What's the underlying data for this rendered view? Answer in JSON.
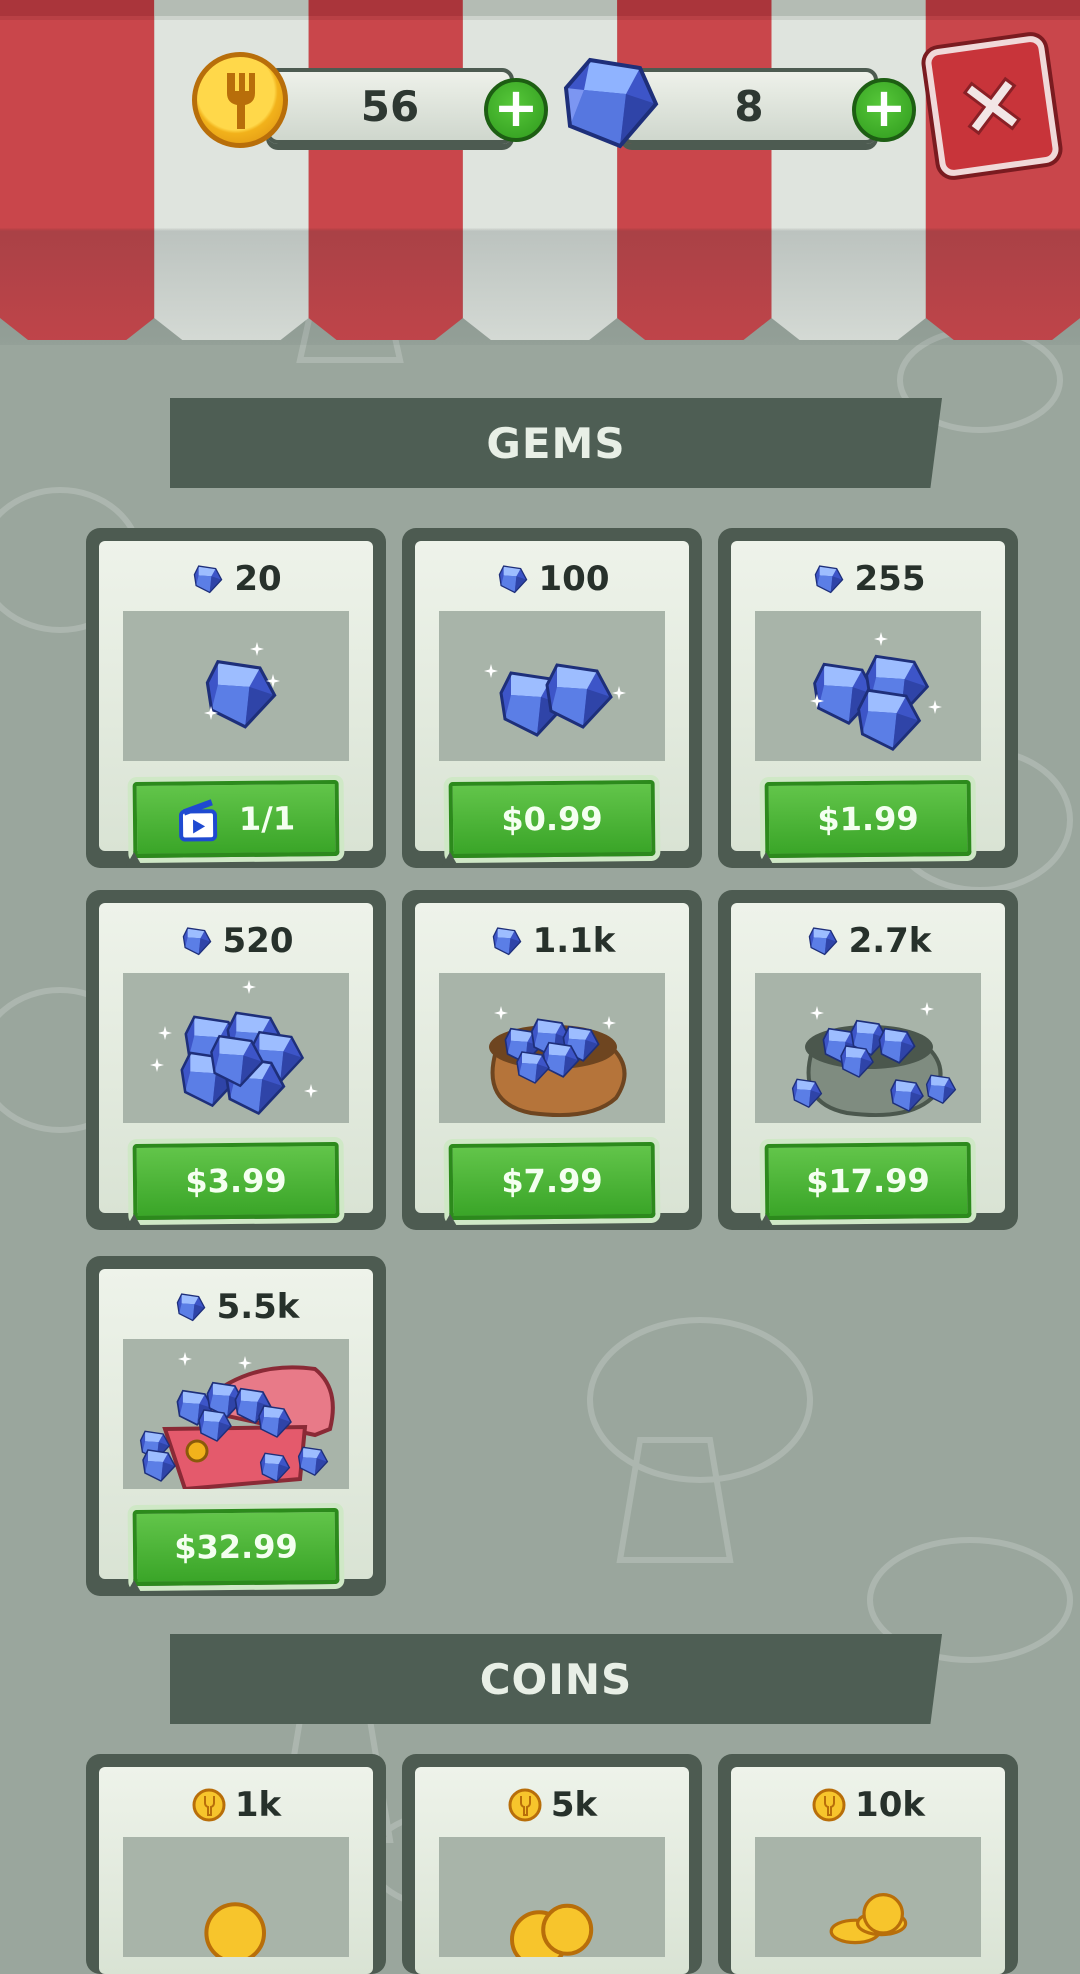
{
  "header": {
    "coins": "56",
    "gems": "8",
    "add_coins_label": "+",
    "add_gems_label": "+"
  },
  "sections": {
    "gems_title": "GEMS",
    "coins_title": "COINS"
  },
  "gem_offers": [
    {
      "amount": "20",
      "price": "1/1",
      "icon": "gem-single"
    },
    {
      "amount": "100",
      "price": "$0.99",
      "icon": "gem-pair"
    },
    {
      "amount": "255",
      "price": "$1.99",
      "icon": "gem-trio"
    },
    {
      "amount": "520",
      "price": "$3.99",
      "icon": "gem-pile"
    },
    {
      "amount": "1.1k",
      "price": "$7.99",
      "icon": "gem-sack"
    },
    {
      "amount": "2.7k",
      "price": "$17.99",
      "icon": "gem-big-sack"
    },
    {
      "amount": "5.5k",
      "price": "$32.99",
      "icon": "gem-chest"
    }
  ],
  "coin_offers": [
    {
      "amount": "1k",
      "icon": "coin-single"
    },
    {
      "amount": "5k",
      "icon": "coin-pile"
    },
    {
      "amount": "10k",
      "icon": "coin-stack"
    }
  ],
  "colors": {
    "awning_red": "#c9464b",
    "awning_white": "#dfe4de",
    "button_green": "#3aa528",
    "panel_dark": "#4d5b51"
  }
}
